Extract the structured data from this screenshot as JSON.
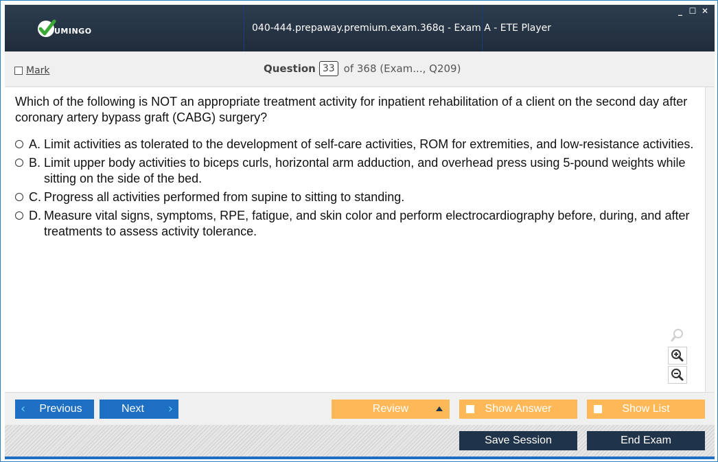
{
  "app": {
    "logo_text": "UMINGO",
    "window_title": "040-444.prepaway.premium.exam.368q - Exam A - ETE Player",
    "window_controls": {
      "minimize": "_",
      "maximize": "☐",
      "close": "✕"
    }
  },
  "header": {
    "mark_label": "Mark",
    "question_label": "Question",
    "question_number": "33",
    "question_of": "of 368 (Exam..., Q209)"
  },
  "question": {
    "text": "Which of the following is NOT an appropriate treatment activity for inpatient rehabilitation of a client on the second day after coronary artery bypass graft (CABG) surgery?",
    "options": [
      {
        "letter": "A.",
        "text": "Limit activities as tolerated to the development of self-care activities, ROM for extremities, and low-resistance activities."
      },
      {
        "letter": "B.",
        "text": "Limit upper body activities to biceps curls, horizontal arm adduction, and overhead press using 5-pound weights while sitting on the side of the bed."
      },
      {
        "letter": "C.",
        "text": "Progress all activities performed from supine to sitting to standing."
      },
      {
        "letter": "D.",
        "text": "Measure vital signs, symptoms, RPE, fatigue, and skin color and perform electrocardiography before, during, and after treatments to assess activity tolerance."
      }
    ]
  },
  "nav": {
    "previous_label": "Previous",
    "next_label": "Next",
    "review_label": "Review",
    "show_answer_label": "Show Answer",
    "show_list_label": "Show List",
    "save_session_label": "Save Session",
    "end_exam_label": "End Exam"
  },
  "colors": {
    "accent_blue": "#1c6fc3",
    "orange": "#fdb858",
    "dark_navy": "#1f334a",
    "title_bar": "#2d3d4f"
  },
  "icons": [
    "check-logo-icon",
    "zoom-reset-icon",
    "zoom-in-icon",
    "zoom-out-icon",
    "chevron-left-icon",
    "chevron-right-icon",
    "triangle-up-icon"
  ]
}
